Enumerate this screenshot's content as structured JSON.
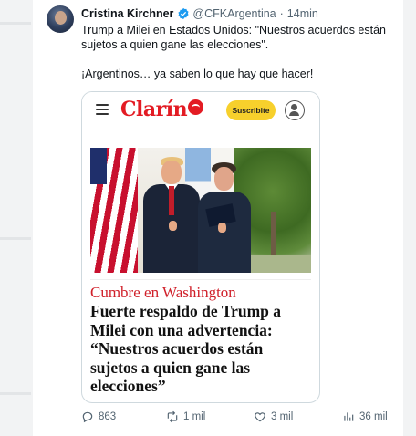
{
  "tweet": {
    "author_name": "Cristina Kirchner",
    "handle": "@CFKArgentina",
    "separator": "·",
    "time": "14min",
    "text_line1": "Trump a Milei en Estados Unidos: \"Nuestros acuerdos están sujetos a quien gane las elecciones\".",
    "text_line2": "¡Argentinos… ya saben lo que hay que hacer!"
  },
  "card": {
    "logo": "Clarín",
    "subscribe_label": "Suscribite",
    "section": "Cumbre en Washington",
    "headline_lines": [
      "Fuerte respaldo de Trump a",
      "Milei con una advertencia:",
      "“Nuestros acuerdos están",
      "sujetos a quien gane las",
      "elecciones”"
    ]
  },
  "actions": {
    "replies": "863",
    "reposts": "1 mil",
    "likes": "3 mil",
    "views": "36 mil"
  },
  "icons": {
    "verified": "verified-badge-icon",
    "reply": "reply-icon",
    "repost": "repost-icon",
    "like": "heart-icon",
    "views": "views-icon",
    "menu": "hamburger-menu-icon",
    "account": "user-account-icon"
  },
  "colors": {
    "accent_blue": "#1d9bf0",
    "clarin_red": "#e31b23",
    "subscribe_yellow": "#f7d02c",
    "section_red": "#d0202a"
  }
}
